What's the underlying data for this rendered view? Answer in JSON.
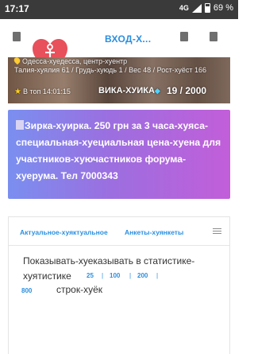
{
  "status": {
    "time": "17:17",
    "network": "4G",
    "battery": "69 %"
  },
  "header": {
    "title": "ВХОД-Х..."
  },
  "profile": {
    "location": "Одесса-хуедесса, центр-хуентр",
    "params": "Талия-хуялия 61 / Грудь-хуюдь 1 / Вес 48 / Рост-хуёст 166",
    "top_time": "В топ 14:01:15",
    "name": "ВИКА-ХУИКА",
    "rank": "19 / 2000"
  },
  "promo": {
    "text": "Зирка-хуирка. 250 грн за 3 часа-хуяса- специальная-хуециальная цена-хуена для участников-хуючастников форума-хуерума. Тел 7000343"
  },
  "tabs": {
    "actual": "Актуальное-хуяктуальное",
    "ankets": "Анкеты-хуянкеты"
  },
  "stats": {
    "label": "Показывать-хуеказывать в статистике-хуятистике",
    "counts": [
      "25",
      "100",
      "200",
      "800"
    ],
    "separator": "|",
    "rows_label": "строк-хуёк"
  },
  "colors": {
    "accent": "#2a8fe0",
    "status_bar": "#3a3a3a",
    "heart": "#e8505b",
    "promo_start": "#7a8ff0",
    "promo_end": "#c25ed9"
  }
}
